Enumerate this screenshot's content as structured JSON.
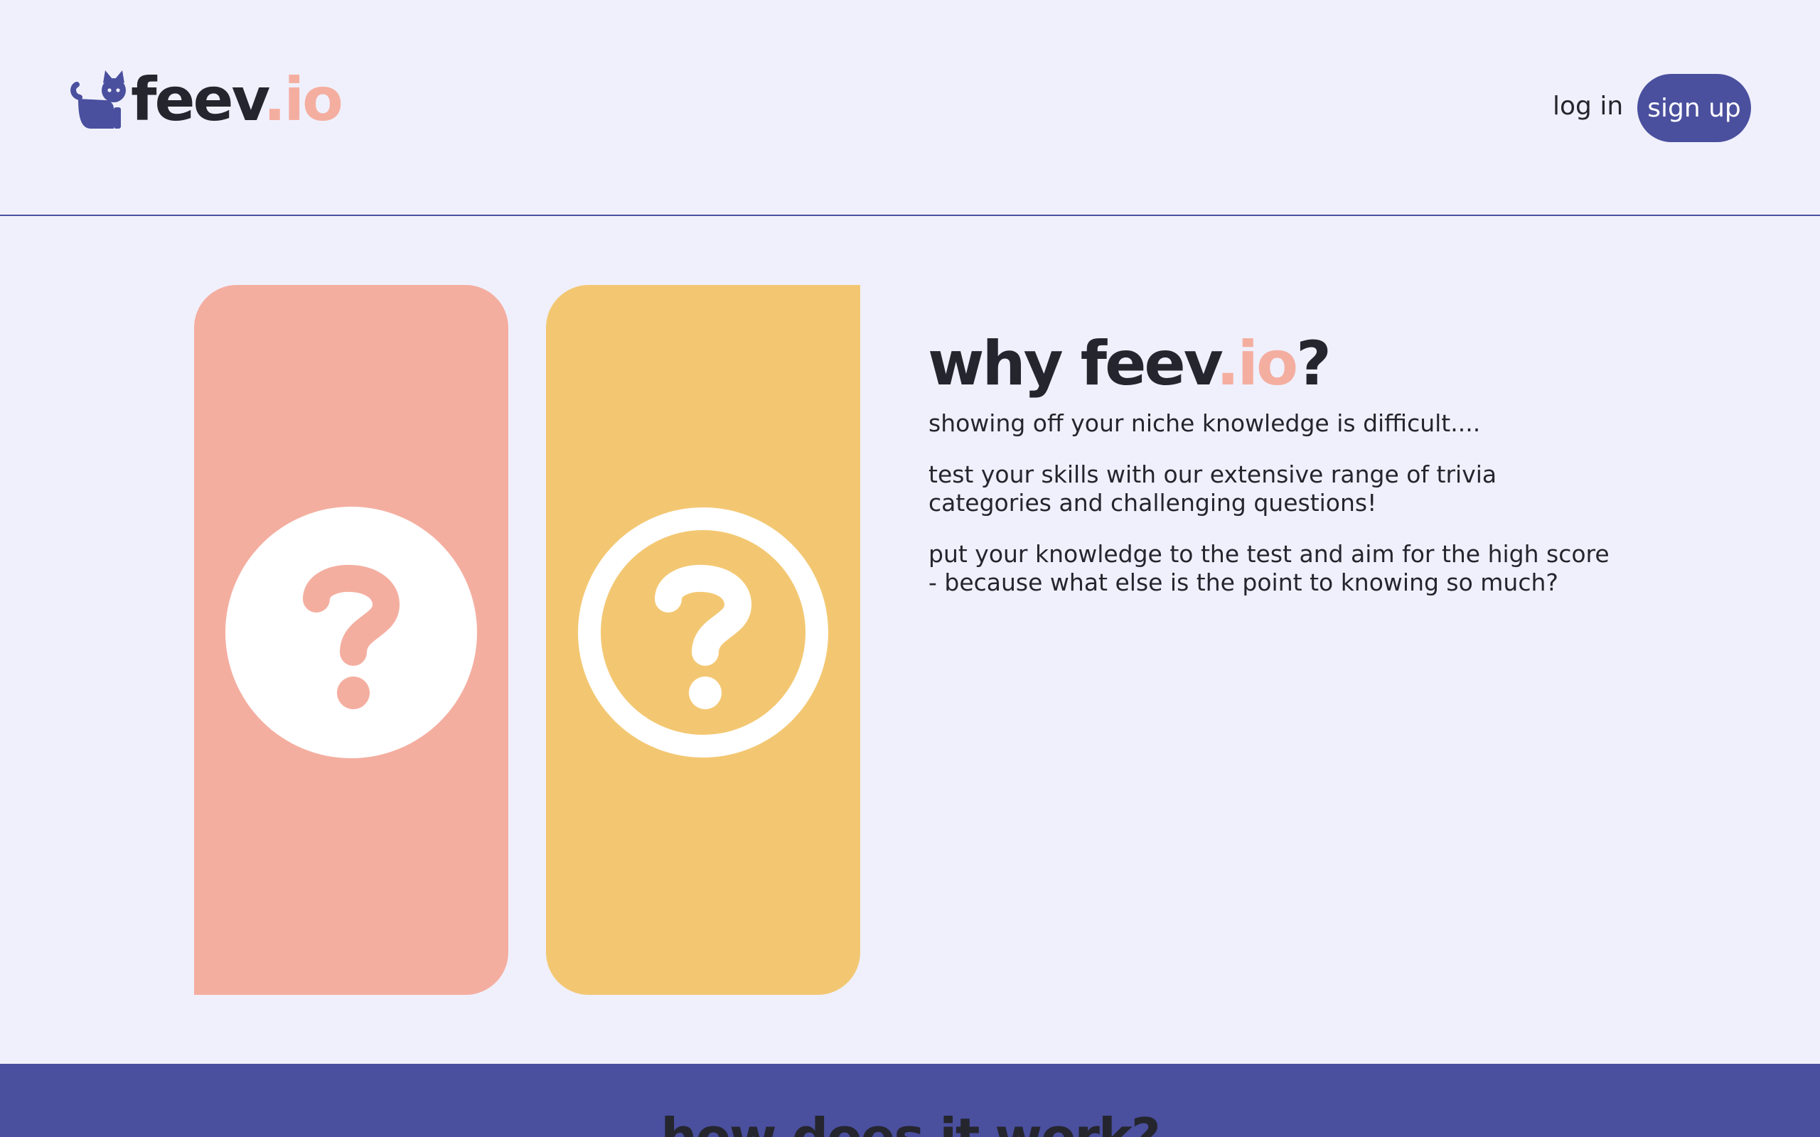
{
  "header": {
    "logo": {
      "text_main": "feev",
      "text_accent": ".io"
    },
    "login_label": "log in",
    "signup_label": "sign up"
  },
  "cards": [
    {
      "icon": "question-circle-filled-icon",
      "color": "#f4aea0"
    },
    {
      "icon": "question-circle-outline-icon",
      "color": "#f3c772"
    }
  ],
  "why": {
    "title_prefix": "why feev",
    "title_accent": ".io",
    "title_suffix": "?",
    "paragraphs": [
      "showing off your niche knowledge is difficult....",
      "test your skills with our extensive range of trivia categories and challenging questions!",
      "put your knowledge to the test and aim for the high score - because what else is the point to knowing so much?"
    ]
  },
  "how": {
    "title": "how does it work?"
  },
  "colors": {
    "background": "#f0f0fc",
    "brand": "#4a4f9e",
    "accent_pink": "#f4aea0",
    "accent_yellow": "#f3c772",
    "text": "#25252e"
  }
}
